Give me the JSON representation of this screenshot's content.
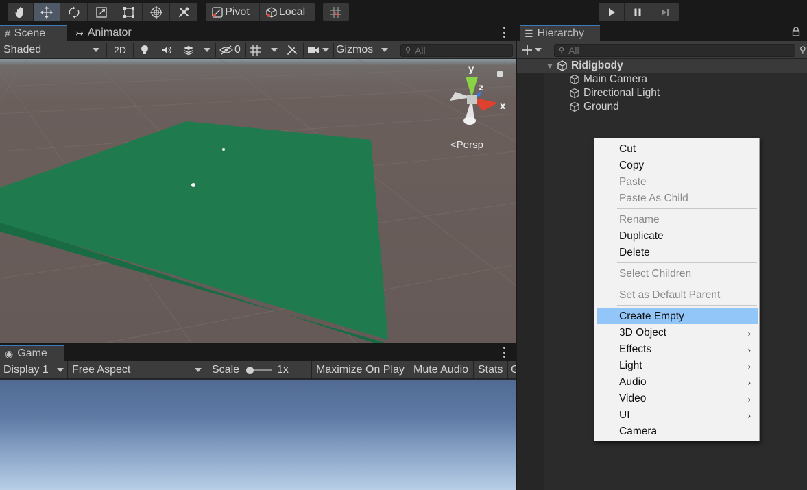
{
  "toolbar": {
    "tools": [
      "hand-tool",
      "move-tool",
      "rotate-tool",
      "scale-tool",
      "rect-tool",
      "transform-tool",
      "custom-tool"
    ],
    "active_tool": "move-tool",
    "pivot_label": "Pivot",
    "local_label": "Local",
    "play_icons": [
      "play-icon",
      "pause-icon",
      "step-icon"
    ]
  },
  "scene": {
    "tabs": {
      "scene": "Scene",
      "animator": "Animator"
    },
    "shading": "Shaded",
    "mode_2d": "2D",
    "hidden_count": "0",
    "gizmos": "Gizmos",
    "search_placeholder": "All",
    "persp": "Persp",
    "axis": {
      "x": "x",
      "y": "y",
      "z": "z"
    },
    "colors": {
      "ground": "#1f7a4e",
      "sky": "#8a9aa1",
      "floor": "#655a57"
    }
  },
  "game": {
    "tab": "Game",
    "display": "Display 1",
    "aspect": "Free Aspect",
    "scale_label": "Scale",
    "scale_value": "1x",
    "maximize": "Maximize On Play",
    "mute": "Mute Audio",
    "stats": "Stats",
    "gizmos_cut": "G"
  },
  "hierarchy": {
    "tab": "Hierarchy",
    "search_placeholder": "All",
    "scene_name": "Ridigbody",
    "objects": [
      "Main Camera",
      "Directional Light",
      "Ground"
    ]
  },
  "context_menu": {
    "items": [
      {
        "label": "Cut",
        "enabled": true
      },
      {
        "label": "Copy",
        "enabled": true
      },
      {
        "label": "Paste",
        "enabled": false
      },
      {
        "label": "Paste As Child",
        "enabled": false
      },
      {
        "label": "Rename",
        "enabled": false
      },
      {
        "label": "Duplicate",
        "enabled": true
      },
      {
        "label": "Delete",
        "enabled": true
      },
      {
        "label": "Select Children",
        "enabled": false
      },
      {
        "label": "Set as Default Parent",
        "enabled": false
      },
      {
        "label": "Create Empty",
        "enabled": true,
        "highlighted": true
      },
      {
        "label": "3D Object",
        "enabled": true,
        "submenu": true
      },
      {
        "label": "Effects",
        "enabled": true,
        "submenu": true
      },
      {
        "label": "Light",
        "enabled": true,
        "submenu": true
      },
      {
        "label": "Audio",
        "enabled": true,
        "submenu": true
      },
      {
        "label": "Video",
        "enabled": true,
        "submenu": true
      },
      {
        "label": "UI",
        "enabled": true,
        "submenu": true
      },
      {
        "label": "Camera",
        "enabled": true
      }
    ],
    "highlight_color": "#92c6f8"
  }
}
